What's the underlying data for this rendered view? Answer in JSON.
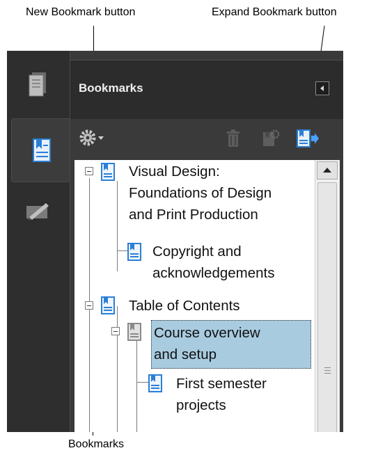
{
  "callouts": {
    "new_bookmark": "New Bookmark button",
    "expand_bookmark": "Expand Bookmark button",
    "bookmarks": "Bookmarks"
  },
  "panel": {
    "title": "Bookmarks"
  },
  "toolbar": {
    "gear_icon": "gear-icon",
    "trash_icon": "trash-icon",
    "properties_icon": "bookmark-properties-icon",
    "expand_icon": "expand-bookmark-icon"
  },
  "tree": [
    {
      "label_line1": "Visual Design:",
      "label_line2": "Foundations of Design",
      "label_line3": "and Print Production"
    },
    {
      "label_line1": "Copyright and",
      "label_line2": "acknowledgements"
    },
    {
      "label_line1": "Table of Contents"
    },
    {
      "label_line1": "Course overview",
      "label_line2": "and setup"
    },
    {
      "label_line1": "First semester",
      "label_line2": "projects"
    }
  ],
  "colors": {
    "selection": "#a8cbe0",
    "bookmark_icon_blue": "#2a7fd6",
    "panel_dark": "#2c2c2c"
  }
}
